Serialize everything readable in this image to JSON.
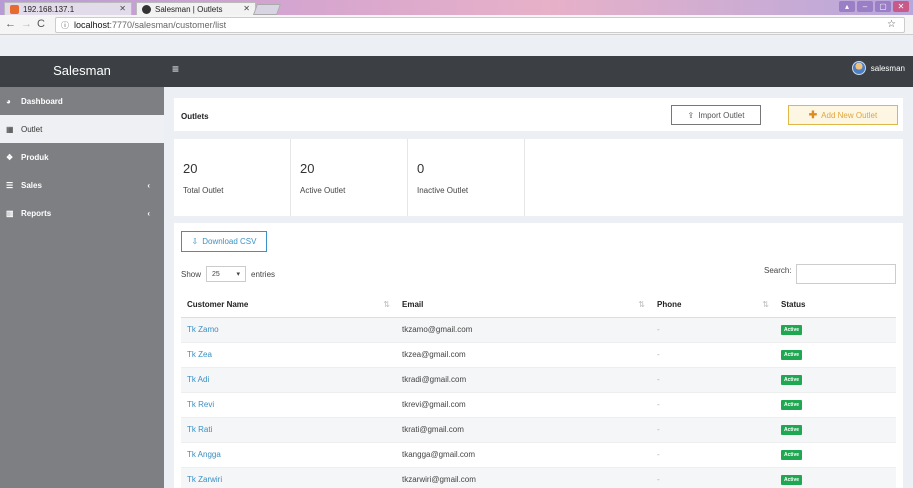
{
  "browser": {
    "tabs": [
      {
        "label": "192.168.137.1",
        "active": false
      },
      {
        "label": "Salesman | Outlets",
        "active": true
      }
    ],
    "url_host": "localhost",
    "url_path": ":7770/salesman/customer/list"
  },
  "app": {
    "brand": "Salesman",
    "user_name": "salesman"
  },
  "sidebar": {
    "items": [
      {
        "label": "Dashboard",
        "icon": "dashboard-icon",
        "glyph": "◕"
      },
      {
        "label": "Outlet",
        "icon": "store-icon",
        "glyph": "▦"
      },
      {
        "label": "Produk",
        "icon": "cubes-icon",
        "glyph": "❖"
      },
      {
        "label": "Sales",
        "icon": "list-icon",
        "glyph": "☰"
      },
      {
        "label": "Reports",
        "icon": "bar-chart-icon",
        "glyph": "▥"
      }
    ]
  },
  "outlets": {
    "title": "Outlets",
    "import_label": "Import Outlet",
    "add_label": "Add New Outlet"
  },
  "stats": [
    {
      "value": "20",
      "label": "Total Outlet"
    },
    {
      "value": "20",
      "label": "Active Outlet"
    },
    {
      "value": "0",
      "label": "Inactive Outlet"
    }
  ],
  "table": {
    "download_label": "Download CSV",
    "show_label": "Show",
    "entries_value": "25",
    "entries_label": "entries",
    "search_label": "Search:",
    "columns": [
      "Customer Name",
      "Email",
      "Phone",
      "Status"
    ],
    "rows": [
      {
        "name": "Tk Zamo",
        "email": "tkzamo@gmail.com",
        "phone": "-",
        "status": "Active"
      },
      {
        "name": "Tk Zea",
        "email": "tkzea@gmail.com",
        "phone": "-",
        "status": "Active"
      },
      {
        "name": "Tk Adi",
        "email": "tkradi@gmail.com",
        "phone": "-",
        "status": "Active"
      },
      {
        "name": "Tk Revi",
        "email": "tkrevi@gmail.com",
        "phone": "-",
        "status": "Active"
      },
      {
        "name": "Tk Rati",
        "email": "tkrati@gmail.com",
        "phone": "-",
        "status": "Active"
      },
      {
        "name": "Tk Angga",
        "email": "tkangga@gmail.com",
        "phone": "-",
        "status": "Active"
      },
      {
        "name": "Tk Zarwiri",
        "email": "tkzarwiri@gmail.com",
        "phone": "-",
        "status": "Active"
      }
    ]
  }
}
